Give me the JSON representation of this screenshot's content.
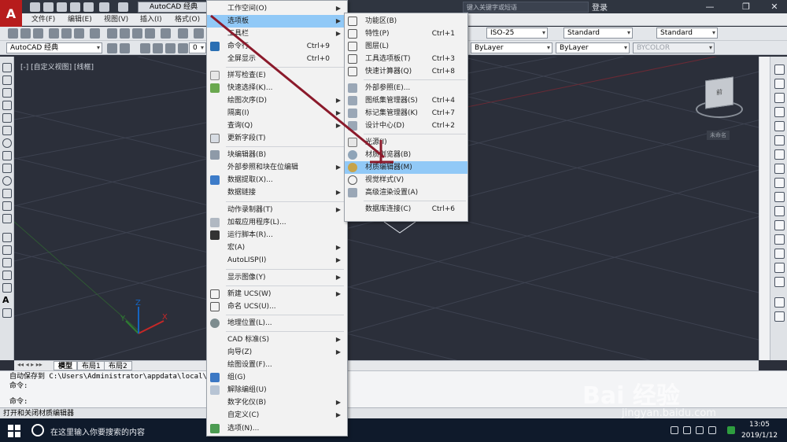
{
  "titlebar": {
    "workspace": "AutoCAD 经典",
    "search_placeholder": "键入关键字或短语",
    "login": "登录",
    "minimize": "—",
    "restore": "❐",
    "close": "✕"
  },
  "menubar": {
    "items": [
      "文件(F)",
      "编辑(E)",
      "视图(V)",
      "插入(I)",
      "格式(O)"
    ]
  },
  "toolbar": {
    "workspace_combo": "AutoCAD 经典",
    "text_style": "ISO-25",
    "dim_style": "Standard",
    "table_style": "Standard",
    "layer": "0",
    "linetype1": "ByLayer",
    "linetype2": "ByLayer",
    "color": "BYCOLOR"
  },
  "viewport": {
    "label": "[-] [自定义视图] [线框]",
    "cube_face": "前",
    "wcs": "未命名"
  },
  "layout_tabs": [
    "模型",
    "布局1",
    "布局2"
  ],
  "command": {
    "history": [
      "自动保存到 C:\\Users\\Administrator\\appdata\\local\\t",
      "命令:"
    ],
    "prompt": "命令:"
  },
  "status_text": "打开和关闭材质编辑器",
  "taskbar": {
    "search_text": "在这里输入你要搜索的内容",
    "time": "13:05",
    "date": "2019/1/12"
  },
  "watermark": {
    "logo": "Bai 经验",
    "url": "jingyan.baidu.com"
  },
  "tools_menu": {
    "items": [
      {
        "label": "工作空间(O)",
        "shortcut": "",
        "submenu": true
      },
      {
        "label": "选项板",
        "shortcut": "",
        "submenu": true
      },
      {
        "label": "工具栏",
        "shortcut": "",
        "submenu": true
      },
      {
        "label": "命令行",
        "shortcut": "Ctrl+9",
        "submenu": false
      },
      {
        "label": "全屏显示",
        "shortcut": "Ctrl+0",
        "submenu": false
      },
      {
        "label": "拼写检查(E)",
        "shortcut": "",
        "submenu": false
      },
      {
        "label": "快速选择(K)...",
        "shortcut": "",
        "submenu": false
      },
      {
        "label": "绘图次序(D)",
        "shortcut": "",
        "submenu": true
      },
      {
        "label": "隔离(I)",
        "shortcut": "",
        "submenu": true
      },
      {
        "label": "查询(Q)",
        "shortcut": "",
        "submenu": true
      },
      {
        "label": "更新字段(T)",
        "shortcut": "",
        "submenu": false
      },
      {
        "label": "块编辑器(B)",
        "shortcut": "",
        "submenu": false
      },
      {
        "label": "外部参照和块在位编辑",
        "shortcut": "",
        "submenu": true
      },
      {
        "label": "数据提取(X)...",
        "shortcut": "",
        "submenu": false
      },
      {
        "label": "数据链接",
        "shortcut": "",
        "submenu": true
      },
      {
        "label": "动作录制器(T)",
        "shortcut": "",
        "submenu": true
      },
      {
        "label": "加载应用程序(L)...",
        "shortcut": "",
        "submenu": false
      },
      {
        "label": "运行脚本(R)...",
        "shortcut": "",
        "submenu": false
      },
      {
        "label": "宏(A)",
        "shortcut": "",
        "submenu": true
      },
      {
        "label": "AutoLISP(I)",
        "shortcut": "",
        "submenu": true
      },
      {
        "label": "显示图像(Y)",
        "shortcut": "",
        "submenu": true
      },
      {
        "label": "新建 UCS(W)",
        "shortcut": "",
        "submenu": true
      },
      {
        "label": "命名 UCS(U)...",
        "shortcut": "",
        "submenu": false
      },
      {
        "label": "地理位置(L)...",
        "shortcut": "",
        "submenu": false
      },
      {
        "label": "CAD 标准(S)",
        "shortcut": "",
        "submenu": true
      },
      {
        "label": "向导(Z)",
        "shortcut": "",
        "submenu": true
      },
      {
        "label": "绘图设置(F)...",
        "shortcut": "",
        "submenu": false
      },
      {
        "label": "组(G)",
        "shortcut": "",
        "submenu": false
      },
      {
        "label": "解除编组(U)",
        "shortcut": "",
        "submenu": false
      },
      {
        "label": "数字化仪(B)",
        "shortcut": "",
        "submenu": true
      },
      {
        "label": "自定义(C)",
        "shortcut": "",
        "submenu": true
      },
      {
        "label": "选项(N)...",
        "shortcut": "",
        "submenu": false
      }
    ]
  },
  "palettes_menu": {
    "items": [
      {
        "label": "功能区(B)",
        "shortcut": ""
      },
      {
        "label": "特性(P)",
        "shortcut": "Ctrl+1"
      },
      {
        "label": "图层(L)",
        "shortcut": ""
      },
      {
        "label": "工具选项板(T)",
        "shortcut": "Ctrl+3"
      },
      {
        "label": "快速计算器(Q)",
        "shortcut": "Ctrl+8"
      },
      {
        "label": "外部参照(E)...",
        "shortcut": ""
      },
      {
        "label": "图纸集管理器(S)",
        "shortcut": "Ctrl+4"
      },
      {
        "label": "标记集管理器(K)",
        "shortcut": "Ctrl+7"
      },
      {
        "label": "设计中心(D)",
        "shortcut": "Ctrl+2"
      },
      {
        "label": "光源(I)",
        "shortcut": ""
      },
      {
        "label": "材质浏览器(B)",
        "shortcut": ""
      },
      {
        "label": "材质编辑器(M)",
        "shortcut": ""
      },
      {
        "label": "视觉样式(V)",
        "shortcut": ""
      },
      {
        "label": "高级渲染设置(A)",
        "shortcut": ""
      },
      {
        "label": "数据库连接(C)",
        "shortcut": "Ctrl+6"
      }
    ]
  },
  "colors": {
    "highlight": "#91c9f7",
    "arrow": "#8b1a2b",
    "canvas": "#2b2f3a"
  }
}
